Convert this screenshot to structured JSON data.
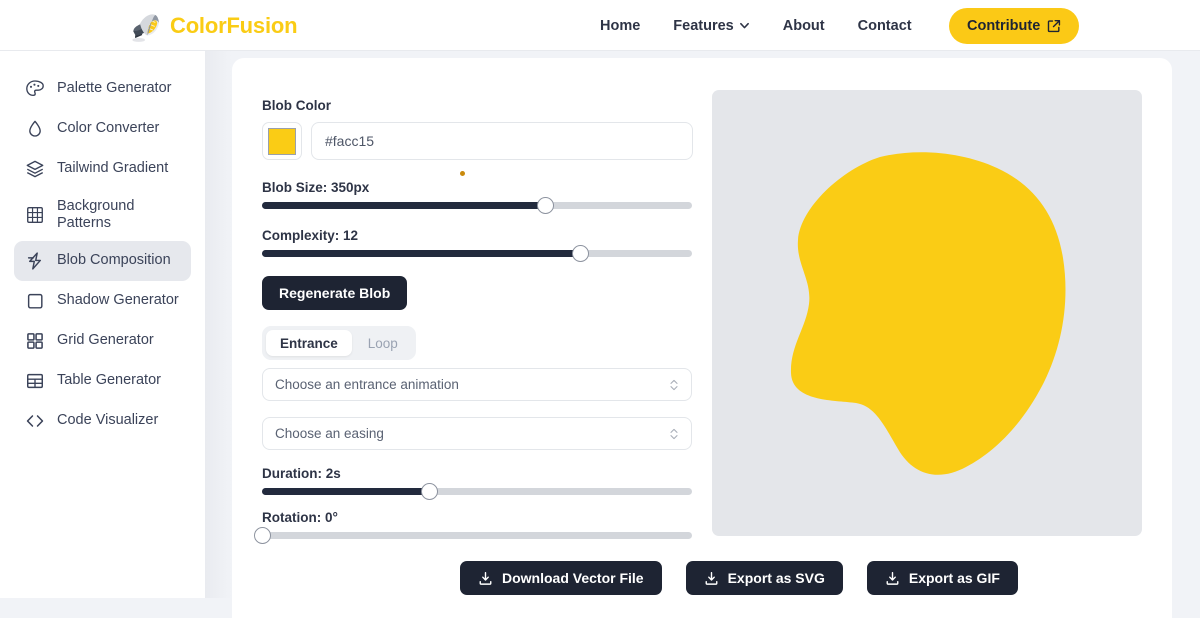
{
  "brand": {
    "name": "ColorFusion",
    "logo_icon": "paint-can-icon",
    "accent_color": "#facc15"
  },
  "nav": {
    "links": [
      {
        "label": "Home",
        "has_caret": false
      },
      {
        "label": "Features",
        "has_caret": true
      },
      {
        "label": "About",
        "has_caret": false
      },
      {
        "label": "Contact",
        "has_caret": false
      }
    ],
    "cta": {
      "label": "Contribute",
      "icon": "external-link-icon",
      "bg_color": "#fbc916"
    }
  },
  "sidebar": {
    "items": [
      {
        "label": "Palette Generator",
        "icon": "palette-icon",
        "active": false
      },
      {
        "label": "Color Converter",
        "icon": "droplet-icon",
        "active": false
      },
      {
        "label": "Tailwind Gradient",
        "icon": "layers-icon",
        "active": false
      },
      {
        "label": "Background Patterns",
        "icon": "grid-lines-icon",
        "active": false
      },
      {
        "label": "Blob Composition",
        "icon": "lightning-bolt-icon",
        "active": true
      },
      {
        "label": "Shadow Generator",
        "icon": "square-icon",
        "active": false
      },
      {
        "label": "Grid Generator",
        "icon": "four-squares-icon",
        "active": false
      },
      {
        "label": "Table Generator",
        "icon": "table-icon",
        "active": false
      },
      {
        "label": "Code Visualizer",
        "icon": "code-brackets-icon",
        "active": false
      }
    ]
  },
  "controls": {
    "color": {
      "label": "Blob Color",
      "value": "#facc15",
      "placeholder": "#facc15",
      "swatch_color": "#facc15"
    },
    "blob_size": {
      "label": "Blob Size: 350px",
      "value": 350,
      "unit": "px",
      "percent": 66
    },
    "complexity": {
      "label": "Complexity: 12",
      "value": 12,
      "percent": 74
    },
    "regenerate_label": "Regenerate Blob",
    "tabs": [
      {
        "label": "Entrance",
        "active": true
      },
      {
        "label": "Loop",
        "active": false
      }
    ],
    "animation_select": {
      "value": "Choose an entrance animation",
      "placeholder": "Choose an entrance animation"
    },
    "easing_select": {
      "value": "Choose an easing",
      "placeholder": "Choose an easing"
    },
    "duration": {
      "label": "Duration: 2s",
      "value": 2,
      "unit": "s",
      "percent": 39
    },
    "rotation": {
      "label": "Rotation: 0°",
      "value": 0,
      "unit": "°",
      "percent": 0
    }
  },
  "preview": {
    "background_color": "#e4e6ea",
    "blob_color": "#facc15"
  },
  "exports": [
    {
      "label": "Download Vector File",
      "icon": "download-icon"
    },
    {
      "label": "Export as SVG",
      "icon": "download-icon"
    },
    {
      "label": "Export as GIF",
      "icon": "download-icon"
    }
  ]
}
